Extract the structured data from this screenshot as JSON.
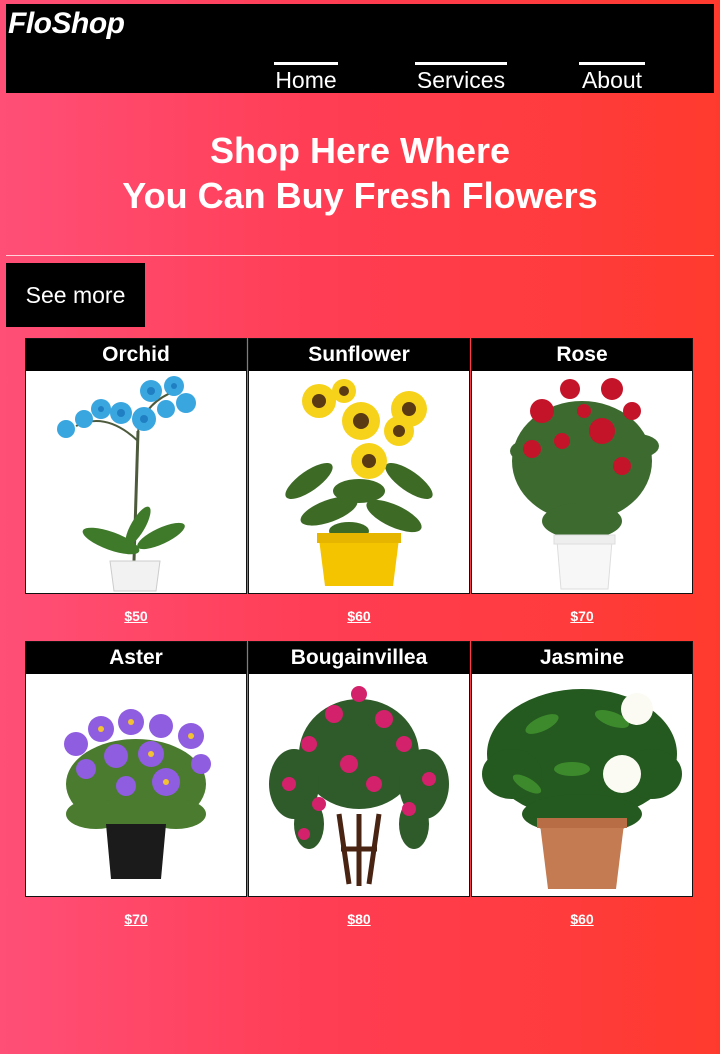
{
  "brand": "FloShop",
  "nav": {
    "home": "Home",
    "services": "Services",
    "about": "About"
  },
  "hero": {
    "line1": "Shop Here Where",
    "line2": "You Can Buy Fresh Flowers"
  },
  "see_more": "See more",
  "products": [
    {
      "name": "Orchid",
      "price": "$50",
      "icon": "orchid-plant-image"
    },
    {
      "name": "Sunflower",
      "price": "$60",
      "icon": "sunflower-plant-image"
    },
    {
      "name": "Rose",
      "price": "$70",
      "icon": "rose-plant-image"
    },
    {
      "name": "Aster",
      "price": "$70",
      "icon": "aster-plant-image"
    },
    {
      "name": "Bougainvillea",
      "price": "$80",
      "icon": "bougainvillea-plant-image"
    },
    {
      "name": "Jasmine",
      "price": "$60",
      "icon": "jasmine-plant-image"
    }
  ],
  "colors": {
    "bar": "#000000",
    "gradient_left": "#ff4f77",
    "gradient_right": "#ff3a2d"
  }
}
